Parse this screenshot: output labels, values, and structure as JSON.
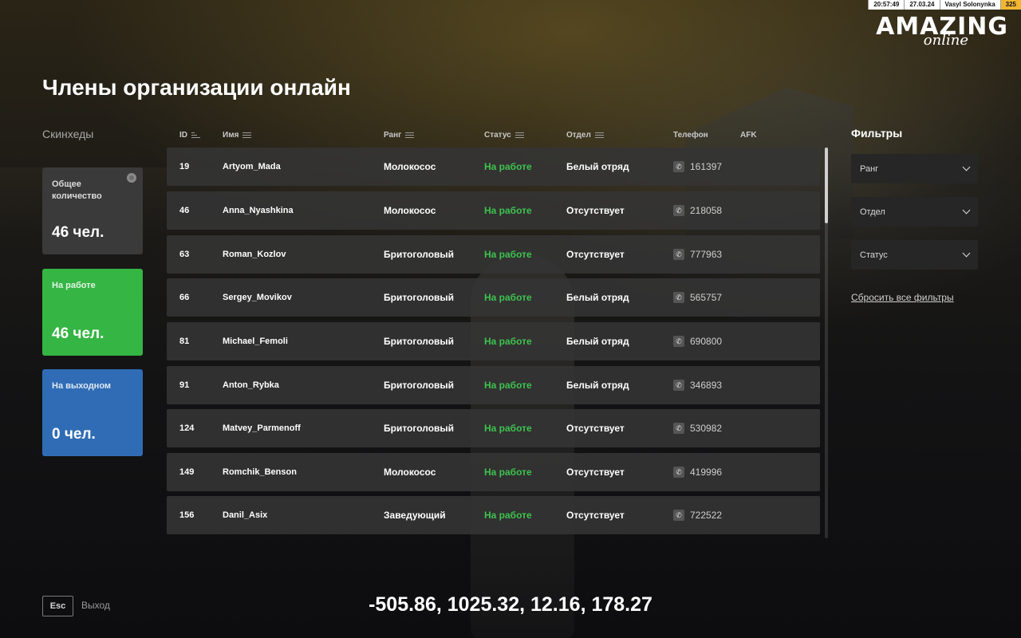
{
  "hud": {
    "time": "20:57:49",
    "date": "27.03.24",
    "player": "Vasyl Solonynka",
    "level": "325"
  },
  "logo": {
    "main": "AMAZING",
    "sub": "online"
  },
  "title": "Члены организации онлайн",
  "sidebar": {
    "section_label": "Скинхеды",
    "cards": {
      "total": {
        "label": "Общее количество",
        "value": "46 чел."
      },
      "working": {
        "label": "На работе",
        "value": "46 чел.",
        "color": "#35b544"
      },
      "off": {
        "label": "На выходном",
        "value": "0 чел.",
        "color": "#2f6cb5"
      }
    }
  },
  "table": {
    "columns": {
      "id": "ID",
      "name": "Имя",
      "rank": "Ранг",
      "status": "Статус",
      "dept": "Отдел",
      "phone": "Телефон",
      "afk": "AFK"
    },
    "rows": [
      {
        "id": "19",
        "name": "Artyom_Mada",
        "rank": "Молокосос",
        "status": "На работе",
        "dept": "Белый отряд",
        "phone": "161397"
      },
      {
        "id": "46",
        "name": "Anna_Nyashkina",
        "rank": "Молокосос",
        "status": "На работе",
        "dept": "Отсутствует",
        "phone": "218058"
      },
      {
        "id": "63",
        "name": "Roman_Kozlov",
        "rank": "Бритоголовый",
        "status": "На работе",
        "dept": "Отсутствует",
        "phone": "777963"
      },
      {
        "id": "66",
        "name": "Sergey_Movikov",
        "rank": "Бритоголовый",
        "status": "На работе",
        "dept": "Белый отряд",
        "phone": "565757"
      },
      {
        "id": "81",
        "name": "Michael_Femoli",
        "rank": "Бритоголовый",
        "status": "На работе",
        "dept": "Белый отряд",
        "phone": "690800"
      },
      {
        "id": "91",
        "name": "Anton_Rybka",
        "rank": "Бритоголовый",
        "status": "На работе",
        "dept": "Белый отряд",
        "phone": "346893"
      },
      {
        "id": "124",
        "name": "Matvey_Parmenoff",
        "rank": "Бритоголовый",
        "status": "На работе",
        "dept": "Отсутствует",
        "phone": "530982"
      },
      {
        "id": "149",
        "name": "Romchik_Benson",
        "rank": "Молокосос",
        "status": "На работе",
        "dept": "Отсутствует",
        "phone": "419996"
      },
      {
        "id": "156",
        "name": "Danil_Asix",
        "rank": "Заведующий",
        "status": "На работе",
        "dept": "Отсутствует",
        "phone": "722522"
      }
    ]
  },
  "filters": {
    "title": "Фильтры",
    "rank": "Ранг",
    "dept": "Отдел",
    "status": "Статус",
    "reset": "Сбросить все фильтры"
  },
  "footer": {
    "esc_key": "Esc",
    "esc_label": "Выход",
    "coords": "-505.86, 1025.32, 12.16, 178.27"
  },
  "colors": {
    "status_green": "#3ec24f",
    "row_bg": "#343434",
    "level_badge": "#f2b632"
  }
}
